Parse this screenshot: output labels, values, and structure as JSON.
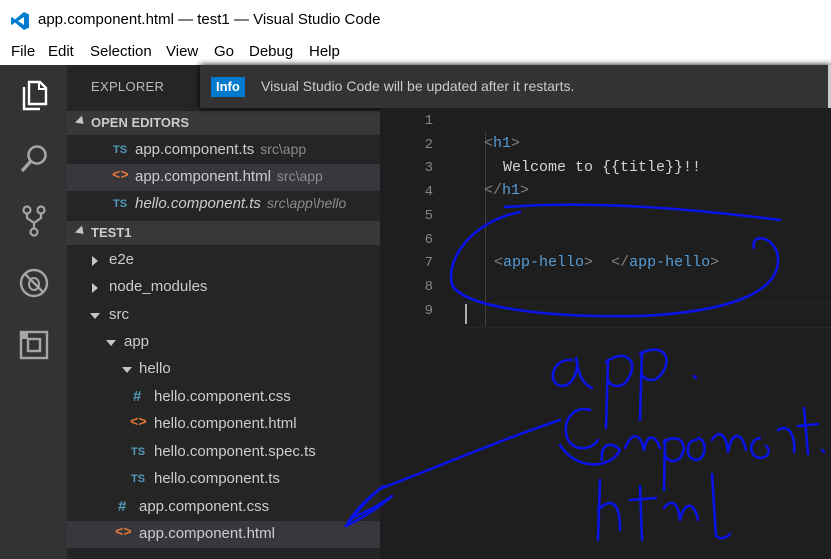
{
  "window": {
    "title": "app.component.html — test1 — Visual Studio Code"
  },
  "menu": [
    "File",
    "Edit",
    "Selection",
    "View",
    "Go",
    "Debug",
    "Help"
  ],
  "activity_bar": [
    "files-icon",
    "search-icon",
    "source-control-icon",
    "debug-icon",
    "extensions-icon"
  ],
  "sidebar": {
    "title": "EXPLORER",
    "open_editors": {
      "label": "OPEN EDITORS",
      "items": [
        {
          "icon": "TS",
          "name": "app.component.ts",
          "path": "src\\app"
        },
        {
          "icon": "<>",
          "name": "app.component.html",
          "path": "src\\app"
        },
        {
          "icon": "TS",
          "name": "hello.component.ts",
          "path": "src\\app\\hello"
        }
      ]
    },
    "project": {
      "label": "TEST1",
      "items": [
        {
          "icon": "",
          "name": "e2e"
        },
        {
          "icon": "",
          "name": "node_modules"
        },
        {
          "icon": "",
          "name": "src"
        },
        {
          "icon": "",
          "name": "app"
        },
        {
          "icon": "",
          "name": "hello"
        },
        {
          "icon": "#",
          "name": "hello.component.css"
        },
        {
          "icon": "<>",
          "name": "hello.component.html"
        },
        {
          "icon": "TS",
          "name": "hello.component.spec.ts"
        },
        {
          "icon": "TS",
          "name": "hello.component.ts"
        },
        {
          "icon": "#",
          "name": "app.component.css"
        },
        {
          "icon": "<>",
          "name": "app.component.html"
        }
      ]
    }
  },
  "notification": {
    "badge": "Info",
    "message": "Visual Studio Code will be updated after it restarts."
  },
  "editor": {
    "line_numbers": [
      "1",
      "2",
      "3",
      "4",
      "5",
      "6",
      "7",
      "8",
      "9"
    ],
    "h1_open": "h1",
    "welcome_text": "Welcome to {{title}}!!",
    "h1_close": "h1",
    "app_hello_open": "app-hello",
    "app_hello_close": "app-hello"
  },
  "colors": {
    "accent": "#007acc",
    "tag": "#569cd6",
    "html_icon": "#e37933",
    "ts_icon": "#519aba",
    "ink": "#0a14e6"
  }
}
